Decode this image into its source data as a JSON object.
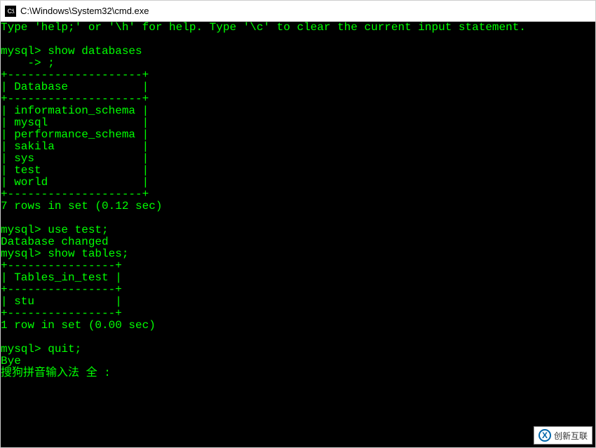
{
  "window": {
    "icon_text": "C:\\",
    "title": "C:\\Windows\\System32\\cmd.exe"
  },
  "terminal": {
    "help_line": "Type 'help;' or '\\h' for help. Type '\\c' to clear the current input statement.",
    "blank": "",
    "prompt1": "mysql> show databases",
    "contline": "    -> ;",
    "div_db": "+--------------------+",
    "hdr_db": "| Database           |",
    "row_db1": "| information_schema |",
    "row_db2": "| mysql              |",
    "row_db3": "| performance_schema |",
    "row_db4": "| sakila             |",
    "row_db5": "| sys                |",
    "row_db6": "| test               |",
    "row_db7": "| world              |",
    "result1": "7 rows in set (0.12 sec)",
    "prompt2": "mysql> use test;",
    "changed": "Database changed",
    "prompt3": "mysql> show tables;",
    "div_tb": "+----------------+",
    "hdr_tb": "| Tables_in_test |",
    "row_tb1": "| stu            |",
    "result2": "1 row in set (0.00 sec)",
    "prompt4": "mysql> quit;",
    "bye": "Bye",
    "ime": "搜狗拼音输入法 全 :"
  },
  "watermark": {
    "icon_text": "X",
    "text": "创新互联"
  }
}
